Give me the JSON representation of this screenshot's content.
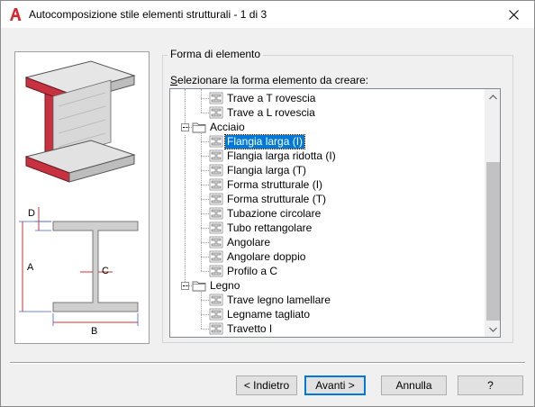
{
  "window": {
    "title": "Autocomposizione stile elementi strutturali - 1 di 3",
    "app_icon": "autocad-a-icon",
    "close_icon": "close-icon"
  },
  "group": {
    "label": "Forma di elemento",
    "tree_label_prefix": "S",
    "tree_label_rest": "elezionare la forma elemento da creare:"
  },
  "preview": {
    "dimension_labels": [
      "D",
      "A",
      "C",
      "B"
    ]
  },
  "tree": {
    "items": [
      {
        "label": "Trave a T rovescia",
        "type": "shape",
        "level": 1,
        "selected": false
      },
      {
        "label": "Trave a L rovescia",
        "type": "shape",
        "level": 1,
        "selected": false
      },
      {
        "label": "Acciaio",
        "type": "folder",
        "level": 0,
        "selected": false
      },
      {
        "label": "Flangia larga (I)",
        "type": "shape",
        "level": 1,
        "selected": true
      },
      {
        "label": "Flangia larga ridotta (I)",
        "type": "shape",
        "level": 1,
        "selected": false
      },
      {
        "label": "Flangia larga (T)",
        "type": "shape",
        "level": 1,
        "selected": false
      },
      {
        "label": "Forma strutturale (I)",
        "type": "shape",
        "level": 1,
        "selected": false
      },
      {
        "label": "Forma strutturale (T)",
        "type": "shape",
        "level": 1,
        "selected": false
      },
      {
        "label": "Tubazione circolare",
        "type": "shape",
        "level": 1,
        "selected": false
      },
      {
        "label": "Tubo rettangolare",
        "type": "shape",
        "level": 1,
        "selected": false
      },
      {
        "label": "Angolare",
        "type": "shape",
        "level": 1,
        "selected": false
      },
      {
        "label": "Angolare doppio",
        "type": "shape",
        "level": 1,
        "selected": false
      },
      {
        "label": "Profilo a C",
        "type": "shape",
        "level": 1,
        "selected": false
      },
      {
        "label": "Legno",
        "type": "folder",
        "level": 0,
        "selected": false
      },
      {
        "label": "Trave legno lamellare",
        "type": "shape",
        "level": 1,
        "selected": false
      },
      {
        "label": "Legname tagliato",
        "type": "shape",
        "level": 1,
        "selected": false
      },
      {
        "label": "Travetto I",
        "type": "shape",
        "level": 1,
        "selected": false
      }
    ]
  },
  "buttons": {
    "back": "< Indietro",
    "next": "Avanti >",
    "cancel": "Annulla",
    "help": "?"
  },
  "colors": {
    "selection": "#0078d7",
    "beam_red": "#c8323c",
    "dimension_red": "#d23232",
    "dimension_blue": "#3c64c8"
  }
}
